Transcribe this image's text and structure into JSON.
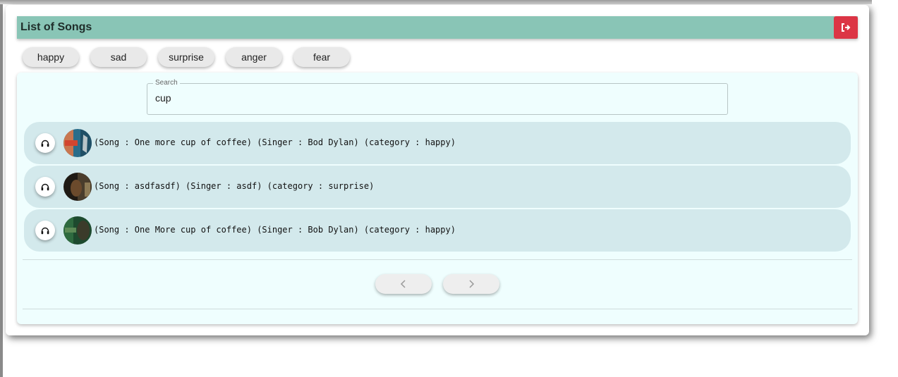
{
  "header": {
    "title": "List of Songs",
    "logout_icon": "sign-out-icon"
  },
  "categories": [
    "happy",
    "sad",
    "surprise",
    "anger",
    "fear"
  ],
  "search": {
    "legend": "Search",
    "value": "cup"
  },
  "songs": [
    {
      "text": "(Song : One more cup of coffee) (Singer : Bod Dylan) (category : happy)"
    },
    {
      "text": "(Song : asdfasdf) (Singer : asdf) (category : surprise)"
    },
    {
      "text": "(Song : One More cup of coffee) (Singer : Bob Dylan) (category : happy)"
    }
  ],
  "pagination": {
    "prev_icon": "chevron-left-icon",
    "next_icon": "chevron-right-icon"
  },
  "colors": {
    "header": "#89c5b6",
    "logout": "#dc3545",
    "panel": "#effefe",
    "row": "#d3e9ec"
  }
}
